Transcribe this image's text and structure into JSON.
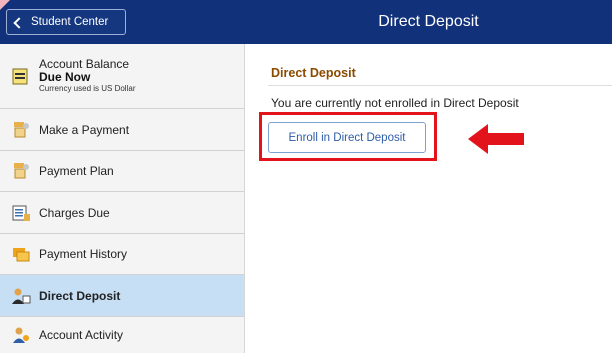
{
  "header": {
    "back_label": "Student Center",
    "title": "Direct Deposit"
  },
  "sidebar": {
    "balance": {
      "title": "Account Balance",
      "due": "Due Now",
      "currency": "Currency used is US Dollar",
      "icon": "balance-document-icon"
    },
    "items": [
      {
        "label": "Make a Payment",
        "icon": "payment-icon",
        "selected": false
      },
      {
        "label": "Payment Plan",
        "icon": "payment-plan-icon",
        "selected": false
      },
      {
        "label": "Charges Due",
        "icon": "charges-due-icon",
        "selected": false
      },
      {
        "label": "Payment History",
        "icon": "payment-history-icon",
        "selected": false
      },
      {
        "label": "Direct Deposit",
        "icon": "direct-deposit-icon",
        "selected": true
      },
      {
        "label": "Account Activity",
        "icon": "account-activity-icon",
        "selected": false
      }
    ]
  },
  "main": {
    "section_title": "Direct Deposit",
    "status_text": "You are currently not enrolled in Direct Deposit",
    "enroll_button_label": "Enroll in Direct Deposit"
  },
  "colors": {
    "header_bg": "#11317a",
    "selected_bg": "#c7dff5",
    "section_title": "#8a4b00",
    "highlight": "#e3131c",
    "button_text": "#2e5da8"
  }
}
